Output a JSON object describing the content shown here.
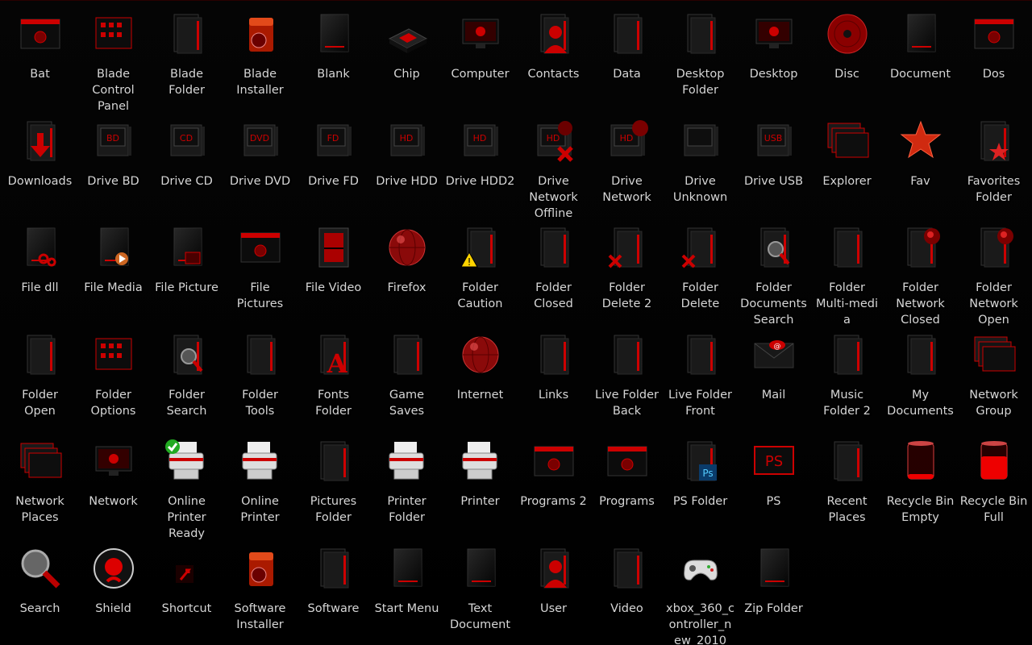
{
  "accent": "#cc0000",
  "background": "#000000",
  "icons": [
    {
      "label": "Bat",
      "icon": "bat-window-gear-icon",
      "kind": "window"
    },
    {
      "label": "Blade\nControl\nPanel",
      "icon": "control-panel-icon",
      "kind": "panel"
    },
    {
      "label": "Blade\nFolder",
      "icon": "folder-icon",
      "kind": "folder"
    },
    {
      "label": "Blade\nInstaller",
      "icon": "installer-box-icon",
      "kind": "box"
    },
    {
      "label": "Blank",
      "icon": "blank-document-icon",
      "kind": "doc"
    },
    {
      "label": "Chip",
      "icon": "chip-icon",
      "kind": "chip"
    },
    {
      "label": "Computer",
      "icon": "monitor-icon",
      "kind": "monitor"
    },
    {
      "label": "Contacts",
      "icon": "contacts-icon",
      "kind": "person"
    },
    {
      "label": "Data",
      "icon": "data-folder-icon",
      "kind": "folder"
    },
    {
      "label": "Desktop\nFolder",
      "icon": "desktop-folder-icon",
      "kind": "folder"
    },
    {
      "label": "Desktop",
      "icon": "desktop-icon",
      "kind": "monitor"
    },
    {
      "label": "Disc",
      "icon": "disc-icon",
      "kind": "disc"
    },
    {
      "label": "Document",
      "icon": "document-icon",
      "kind": "doc"
    },
    {
      "label": "Dos",
      "icon": "dos-window-icon",
      "kind": "window"
    },
    {
      "label": "Downloads",
      "icon": "downloads-arrow-icon",
      "kind": "download"
    },
    {
      "label": "Drive BD",
      "icon": "drive-bd-icon",
      "kind": "drive",
      "tag": "BD"
    },
    {
      "label": "Drive CD",
      "icon": "drive-cd-icon",
      "kind": "drive",
      "tag": "CD"
    },
    {
      "label": "Drive DVD",
      "icon": "drive-dvd-icon",
      "kind": "drive",
      "tag": "DVD"
    },
    {
      "label": "Drive FD",
      "icon": "drive-fd-icon",
      "kind": "drive",
      "tag": "FD"
    },
    {
      "label": "Drive HDD",
      "icon": "drive-hdd-icon",
      "kind": "drive",
      "tag": "HD"
    },
    {
      "label": "Drive HDD2",
      "icon": "drive-hdd2-icon",
      "kind": "drive",
      "tag": "HD"
    },
    {
      "label": "Drive\nNetwork\nOffline",
      "icon": "drive-network-offline-icon",
      "kind": "drivex"
    },
    {
      "label": "Drive\nNetwork",
      "icon": "drive-network-icon",
      "kind": "drivenet"
    },
    {
      "label": "Drive\nUnknown",
      "icon": "drive-unknown-icon",
      "kind": "drive",
      "tag": ""
    },
    {
      "label": "Drive USB",
      "icon": "drive-usb-icon",
      "kind": "drive",
      "tag": "USB"
    },
    {
      "label": "Explorer",
      "icon": "explorer-windows-icon",
      "kind": "stack"
    },
    {
      "label": "Fav",
      "icon": "star-icon",
      "kind": "star"
    },
    {
      "label": "Favorites\nFolder",
      "icon": "favorites-folder-icon",
      "kind": "folderstar"
    },
    {
      "label": "File dll",
      "icon": "file-dll-icon",
      "kind": "filegear"
    },
    {
      "label": "File Media",
      "icon": "file-media-icon",
      "kind": "fileplay"
    },
    {
      "label": "File Picture",
      "icon": "file-picture-icon",
      "kind": "filepic"
    },
    {
      "label": "File\nPictures",
      "icon": "file-pictures-icon",
      "kind": "window"
    },
    {
      "label": "File Video",
      "icon": "file-video-icon",
      "kind": "filmstrip"
    },
    {
      "label": "Firefox",
      "icon": "firefox-icon",
      "kind": "globe"
    },
    {
      "label": "Folder\nCaution",
      "icon": "folder-caution-icon",
      "kind": "foldercaution"
    },
    {
      "label": "Folder\nClosed",
      "icon": "folder-closed-icon",
      "kind": "folder"
    },
    {
      "label": "Folder\nDelete 2",
      "icon": "folder-delete-2-icon",
      "kind": "folderx"
    },
    {
      "label": "Folder\nDelete",
      "icon": "folder-delete-icon",
      "kind": "folderx"
    },
    {
      "label": "Folder\nDocuments\nSearch",
      "icon": "folder-documents-search-icon",
      "kind": "foldersearch"
    },
    {
      "label": "Folder\nMulti-medi\na",
      "icon": "folder-multimedia-icon",
      "kind": "folder"
    },
    {
      "label": "Folder\nNetwork\nClosed",
      "icon": "folder-network-closed-icon",
      "kind": "foldernet"
    },
    {
      "label": "Folder\nNetwork\nOpen",
      "icon": "folder-network-open-icon",
      "kind": "foldernet"
    },
    {
      "label": "Folder\nOpen",
      "icon": "folder-open-icon",
      "kind": "folder"
    },
    {
      "label": "Folder\nOptions",
      "icon": "folder-options-icon",
      "kind": "panel"
    },
    {
      "label": "Folder\nSearch",
      "icon": "folder-search-icon",
      "kind": "foldersearch"
    },
    {
      "label": "Folder\nTools",
      "icon": "folder-tools-icon",
      "kind": "folder"
    },
    {
      "label": "Fonts\nFolder",
      "icon": "fonts-folder-icon",
      "kind": "fonts"
    },
    {
      "label": "Game\nSaves",
      "icon": "game-saves-icon",
      "kind": "folder"
    },
    {
      "label": "Internet",
      "icon": "internet-globe-icon",
      "kind": "globe"
    },
    {
      "label": "Links",
      "icon": "links-folder-icon",
      "kind": "folder"
    },
    {
      "label": "Live Folder\nBack",
      "icon": "live-folder-back-icon",
      "kind": "folder"
    },
    {
      "label": "Live Folder\nFront",
      "icon": "live-folder-front-icon",
      "kind": "folder"
    },
    {
      "label": "Mail",
      "icon": "mail-envelope-icon",
      "kind": "mail"
    },
    {
      "label": "Music\nFolder 2",
      "icon": "music-folder-icon",
      "kind": "folder"
    },
    {
      "label": "My\nDocuments",
      "icon": "my-documents-icon",
      "kind": "folder"
    },
    {
      "label": "Network\nGroup",
      "icon": "network-group-icon",
      "kind": "stack"
    },
    {
      "label": "Network\nPlaces",
      "icon": "network-places-icon",
      "kind": "stack"
    },
    {
      "label": "Network",
      "icon": "network-monitor-icon",
      "kind": "monitor"
    },
    {
      "label": "Online\nPrinter\nReady",
      "icon": "printer-ready-icon",
      "kind": "printercheck"
    },
    {
      "label": "Online\nPrinter",
      "icon": "online-printer-icon",
      "kind": "printer"
    },
    {
      "label": "Pictures\nFolder",
      "icon": "pictures-folder-icon",
      "kind": "folder"
    },
    {
      "label": "Printer\nFolder",
      "icon": "printer-folder-icon",
      "kind": "printer"
    },
    {
      "label": "Printer",
      "icon": "printer-icon",
      "kind": "printer"
    },
    {
      "label": "Programs 2",
      "icon": "programs-2-icon",
      "kind": "window"
    },
    {
      "label": "Programs",
      "icon": "programs-icon",
      "kind": "window"
    },
    {
      "label": "PS Folder",
      "icon": "ps-folder-icon",
      "kind": "folderps"
    },
    {
      "label": "PS",
      "icon": "ps-icon",
      "kind": "ps"
    },
    {
      "label": "Recent\nPlaces",
      "icon": "recent-places-icon",
      "kind": "folder"
    },
    {
      "label": "Recycle Bin\nEmpty",
      "icon": "recycle-bin-empty-icon",
      "kind": "bin",
      "fill": 0.15
    },
    {
      "label": "Recycle Bin\nFull",
      "icon": "recycle-bin-full-icon",
      "kind": "bin",
      "fill": 0.7
    },
    {
      "label": "Search",
      "icon": "magnifier-icon",
      "kind": "search"
    },
    {
      "label": "Shield",
      "icon": "shield-icon",
      "kind": "shield"
    },
    {
      "label": "Shortcut",
      "icon": "shortcut-arrow-icon",
      "kind": "shortcut"
    },
    {
      "label": "Software\nInstaller",
      "icon": "software-installer-icon",
      "kind": "box"
    },
    {
      "label": "Software",
      "icon": "software-icon",
      "kind": "folder"
    },
    {
      "label": "Start Menu",
      "icon": "start-menu-icon",
      "kind": "doc"
    },
    {
      "label": "Text\nDocument",
      "icon": "text-document-icon",
      "kind": "doc"
    },
    {
      "label": "User",
      "icon": "user-icon",
      "kind": "person"
    },
    {
      "label": "Video",
      "icon": "video-folder-icon",
      "kind": "folder"
    },
    {
      "label": "xbox_360_c\nontroller_n\new_2010",
      "icon": "gamepad-icon",
      "kind": "gamepad"
    },
    {
      "label": "Zip Folder",
      "icon": "zip-folder-icon",
      "kind": "doc"
    }
  ]
}
